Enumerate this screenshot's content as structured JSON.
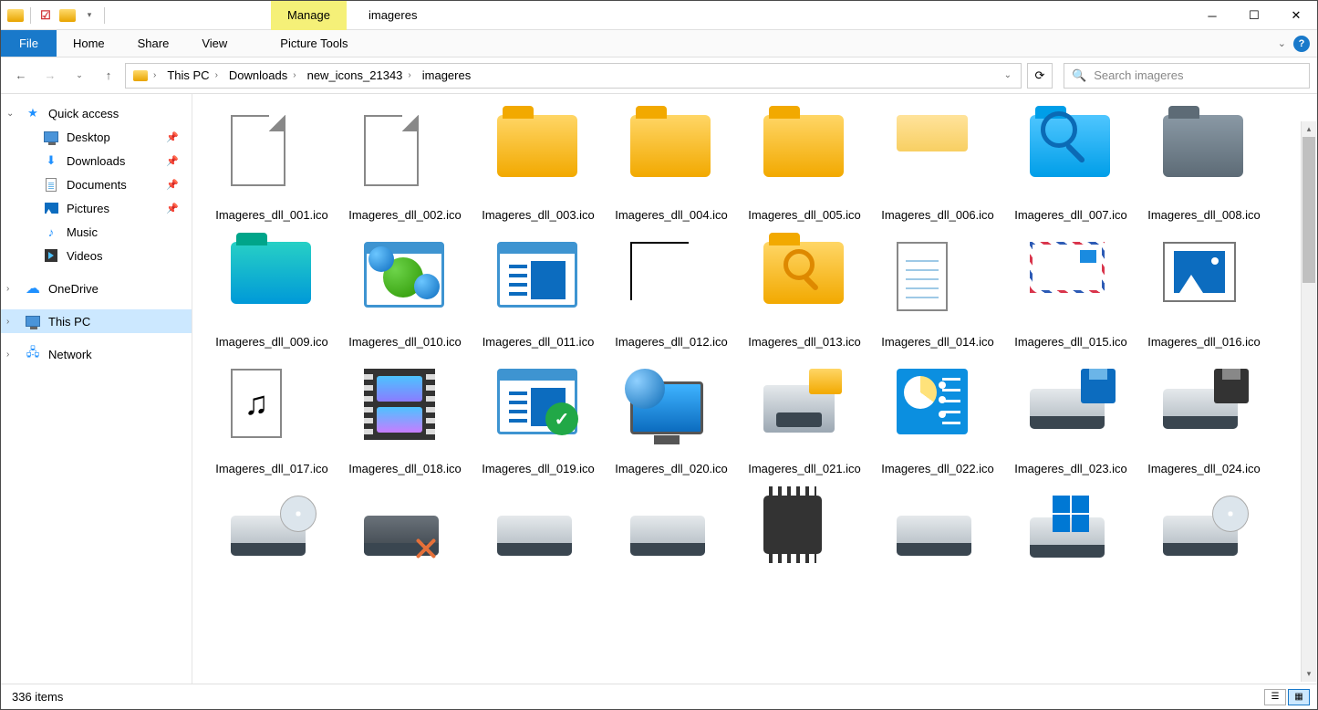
{
  "title": "imageres",
  "manage_tab": "Manage",
  "picture_tools": "Picture Tools",
  "ribbon": {
    "file": "File",
    "home": "Home",
    "share": "Share",
    "view": "View"
  },
  "breadcrumb": [
    "This PC",
    "Downloads",
    "new_icons_21343",
    "imageres"
  ],
  "search_placeholder": "Search imageres",
  "sidebar": {
    "quick_access": "Quick access",
    "desktop": "Desktop",
    "downloads": "Downloads",
    "documents": "Documents",
    "pictures": "Pictures",
    "music": "Music",
    "videos": "Videos",
    "onedrive": "OneDrive",
    "thispc": "This PC",
    "network": "Network"
  },
  "items": [
    {
      "name": "Imageres_dll_001.ico",
      "icon": "file-blank"
    },
    {
      "name": "Imageres_dll_002.ico",
      "icon": "file-blank"
    },
    {
      "name": "Imageres_dll_003.ico",
      "icon": "folder-y"
    },
    {
      "name": "Imageres_dll_004.ico",
      "icon": "folder-y"
    },
    {
      "name": "Imageres_dll_005.ico",
      "icon": "folder-y"
    },
    {
      "name": "Imageres_dll_006.ico",
      "icon": "folder-small"
    },
    {
      "name": "Imageres_dll_007.ico",
      "icon": "folder-blue-search"
    },
    {
      "name": "Imageres_dll_008.ico",
      "icon": "folder-gray"
    },
    {
      "name": "Imageres_dll_009.ico",
      "icon": "folder-teal"
    },
    {
      "name": "Imageres_dll_010.ico",
      "icon": "apps"
    },
    {
      "name": "Imageres_dll_011.ico",
      "icon": "window-doc"
    },
    {
      "name": "Imageres_dll_012.ico",
      "icon": "corner"
    },
    {
      "name": "Imageres_dll_013.ico",
      "icon": "folder-search"
    },
    {
      "name": "Imageres_dll_014.ico",
      "icon": "text-doc"
    },
    {
      "name": "Imageres_dll_015.ico",
      "icon": "envelope"
    },
    {
      "name": "Imageres_dll_016.ico",
      "icon": "picture"
    },
    {
      "name": "Imageres_dll_017.ico",
      "icon": "music-doc"
    },
    {
      "name": "Imageres_dll_018.ico",
      "icon": "film"
    },
    {
      "name": "Imageres_dll_019.ico",
      "icon": "window-check"
    },
    {
      "name": "Imageres_dll_020.ico",
      "icon": "globe-monitor"
    },
    {
      "name": "Imageres_dll_021.ico",
      "icon": "printer"
    },
    {
      "name": "Imageres_dll_022.ico",
      "icon": "control-panel"
    },
    {
      "name": "Imageres_dll_023.ico",
      "icon": "drive-floppy-blue"
    },
    {
      "name": "Imageres_dll_024.ico",
      "icon": "drive-floppy-dark"
    },
    {
      "name": "",
      "icon": "drive-disc"
    },
    {
      "name": "",
      "icon": "drive-x"
    },
    {
      "name": "",
      "icon": "drive"
    },
    {
      "name": "",
      "icon": "drive"
    },
    {
      "name": "",
      "icon": "chip"
    },
    {
      "name": "",
      "icon": "drive"
    },
    {
      "name": "",
      "icon": "drive-win"
    },
    {
      "name": "",
      "icon": "drive-disc"
    }
  ],
  "status": "336 items"
}
